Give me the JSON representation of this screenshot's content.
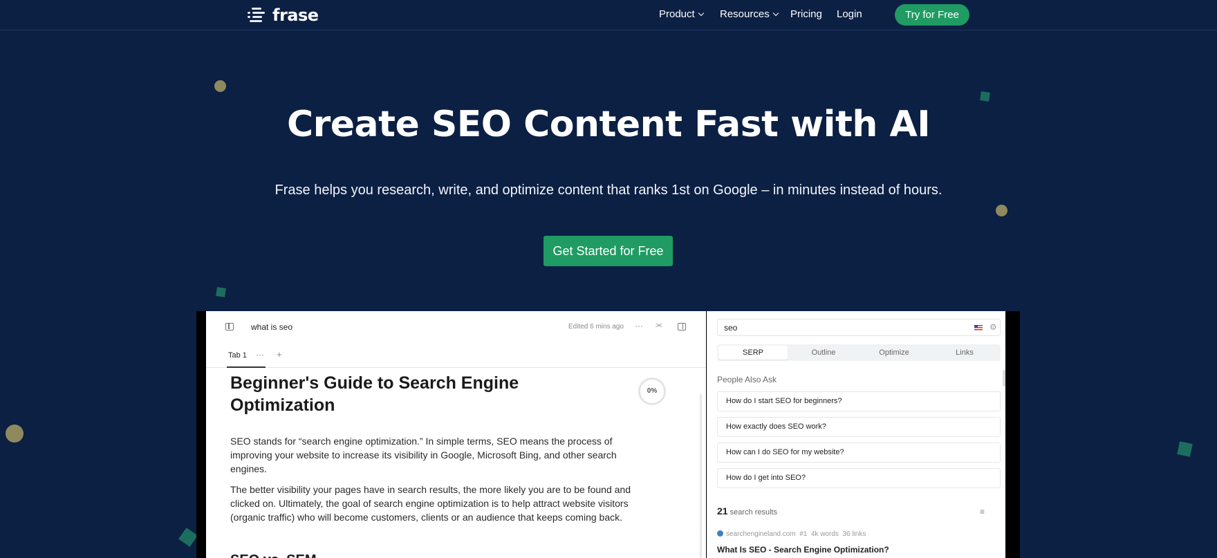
{
  "nav": {
    "logo_text": "frase",
    "links": [
      {
        "label": "Product",
        "has_dropdown": true
      },
      {
        "label": "Resources",
        "has_dropdown": true
      },
      {
        "label": "Pricing",
        "has_dropdown": false
      },
      {
        "label": "Login",
        "has_dropdown": false
      }
    ],
    "cta_label": "Try for Free"
  },
  "hero": {
    "title": "Create SEO Content Fast with AI",
    "subtitle": "Frase helps you research, write, and optimize content that ranks 1st on Google – in minutes instead of hours.",
    "cta_label": "Get Started for Free"
  },
  "colors": {
    "background": "#0c2044",
    "accent_green": "#1f9b63",
    "confetti_dot": "#8f8a5d",
    "confetti_square": "#1d6d5f"
  },
  "editor": {
    "doc_name": "what is seo",
    "edited_status": "Edited 6 mins ago",
    "tab_label": "Tab 1",
    "heading": "Beginner's Guide to Search Engine Optimization",
    "score": "0%",
    "paragraphs": [
      "SEO stands for “search engine optimization.” In simple terms, SEO means the process of improving your website to increase its visibility in Google, Microsoft Bing, and other search engines.",
      "The better visibility your pages have in search results, the more likely you are to be found and clicked on. Ultimately, the goal of search engine optimization is to help attract website visitors (organic traffic) who will become customers, clients or an audience that keeps coming back."
    ],
    "subheading": "SEO vs. SEM"
  },
  "panel": {
    "query": "seo",
    "tabs": [
      "SERP",
      "Outline",
      "Optimize",
      "Links"
    ],
    "active_tab": "SERP",
    "paa_title": "People Also Ask",
    "questions": [
      "How do I start SEO for beginners?",
      "How exactly does SEO work?",
      "How can I do SEO for my website?",
      "How do I get into SEO?"
    ],
    "results_count": "21",
    "results_label": "search results",
    "first_result": {
      "domain": "searchengineland.com",
      "rank": "#1",
      "words": "4k words",
      "links": "36 links",
      "title": "What Is SEO - Search Engine Optimization?"
    }
  }
}
